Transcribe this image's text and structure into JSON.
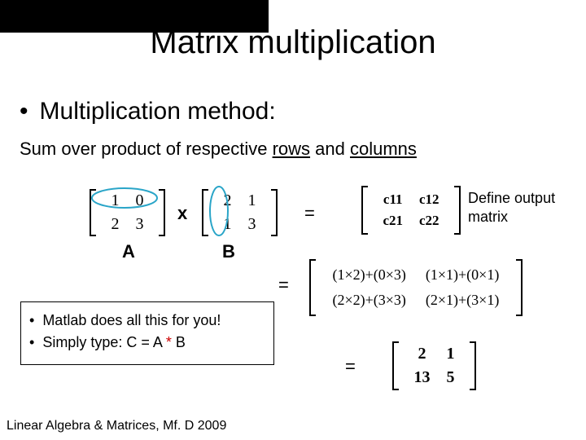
{
  "title": "Matrix multiplication",
  "bullet1": "Multiplication method:",
  "sub1_pre": "Sum over product of respective ",
  "sub1_rows": "rows",
  "sub1_mid": " and ",
  "sub1_cols": "columns",
  "matA": {
    "r1c1": "1",
    "r1c2": "0",
    "r2c1": "2",
    "r2c2": "3"
  },
  "matB": {
    "r1c1": "2",
    "r1c2": "1",
    "r2c1": "1",
    "r2c2": "3"
  },
  "matC": {
    "r1c1": "c11",
    "r1c2": "c12",
    "r2c1": "c21",
    "r2c2": "c22"
  },
  "matD": {
    "r1c1": "(1×2)+(0×3)",
    "r1c2": "(1×1)+(0×1)",
    "r2c1": "(2×2)+(3×3)",
    "r2c2": "(2×1)+(3×1)"
  },
  "matE": {
    "r1c1": "2",
    "r1c2": "1",
    "r2c1": "13",
    "r2c2": "5"
  },
  "opX": "x",
  "labelA": "A",
  "labelB": "B",
  "eq": "=",
  "define_l1": "Define output",
  "define_l2": "matrix",
  "note1": "Matlab does all this for you!",
  "note2_pre": "Simply type: C = A ",
  "note2_star": "*",
  "note2_post": " B",
  "footer": "Linear Algebra & Matrices, Mf. D 2009"
}
